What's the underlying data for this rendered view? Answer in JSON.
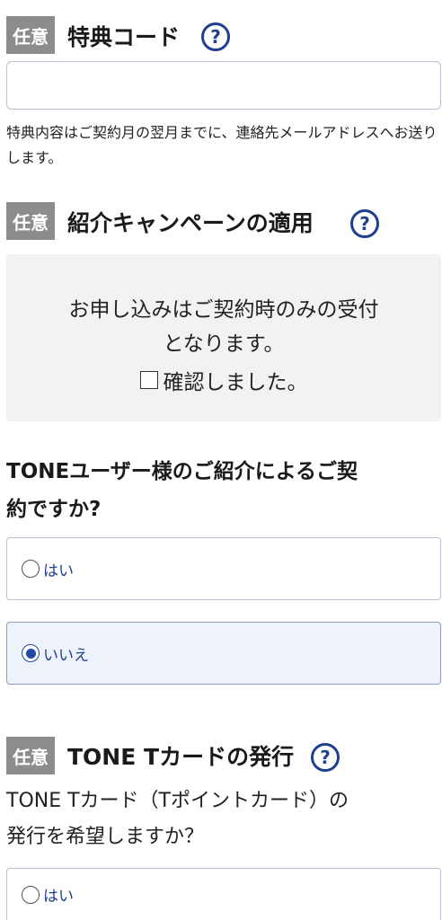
{
  "benefit_code": {
    "badge": "任意",
    "title": "特典コード",
    "help_icon": "?",
    "input_value": "",
    "note": "特典内容はご契約月の翌月までに、連絡先メールアドレスへお送りします。"
  },
  "referral_campaign": {
    "badge": "任意",
    "title": "紹介キャンペーンの適用",
    "help_icon": "?",
    "info_line1": "お申し込みはご契約時のみの受付",
    "info_line2": "となります。",
    "confirm_label": "確認しました。",
    "confirm_checked": false
  },
  "referral_question": {
    "line1": "TONEユーザー様のご紹介によるご契",
    "line2": "約ですか?",
    "options": [
      {
        "label": "はい",
        "selected": false
      },
      {
        "label": "いいえ",
        "selected": true
      }
    ]
  },
  "t_card": {
    "badge": "任意",
    "title": "TONE Tカードの発行",
    "help_icon": "?",
    "question_line1": "TONE Tカード（Tポイントカード）の",
    "question_line2": "発行を希望しますか？",
    "options": [
      {
        "label": "はい",
        "selected": false
      }
    ]
  },
  "colors": {
    "accent": "#1f3f8f",
    "badge_bg": "#8c8c8c",
    "selected_bg": "#eef2fb"
  }
}
